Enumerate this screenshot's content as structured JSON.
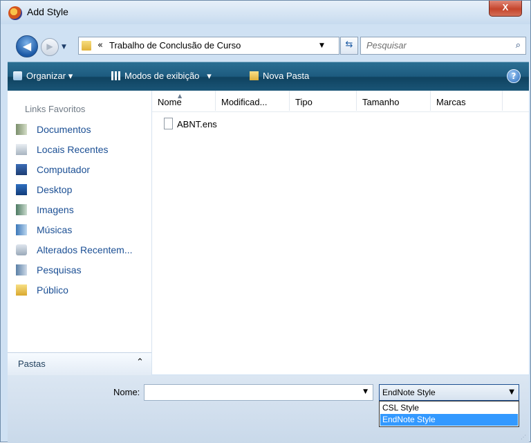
{
  "window": {
    "title": "Add Style",
    "close_label": "X"
  },
  "nav": {
    "breadcrumb_prefix": "«",
    "breadcrumb": "Trabalho de Conclusão de Curso",
    "search_placeholder": "Pesquisar"
  },
  "toolbar": {
    "organize": "Organizar",
    "views": "Modos de exibição",
    "new_folder": "Nova Pasta",
    "help": "?"
  },
  "sidebar": {
    "header": "Links Favoritos",
    "items": [
      {
        "label": "Documentos",
        "icon": "documents-icon"
      },
      {
        "label": "Locais Recentes",
        "icon": "recent-places-icon"
      },
      {
        "label": "Computador",
        "icon": "computer-icon"
      },
      {
        "label": "Desktop",
        "icon": "desktop-icon"
      },
      {
        "label": "Imagens",
        "icon": "pictures-icon"
      },
      {
        "label": "Músicas",
        "icon": "music-icon"
      },
      {
        "label": "Alterados Recentem...",
        "icon": "recently-changed-icon"
      },
      {
        "label": "Pesquisas",
        "icon": "searches-icon"
      },
      {
        "label": "Público",
        "icon": "public-folder-icon"
      }
    ],
    "folders_label": "Pastas"
  },
  "files": {
    "columns": [
      "Nome",
      "Modificad...",
      "Tipo",
      "Tamanho",
      "Marcas"
    ],
    "rows": [
      {
        "name": "ABNT.ens"
      }
    ]
  },
  "bottom": {
    "name_label": "Nome:",
    "name_value": "",
    "type_selected": "EndNote Style",
    "type_options": [
      "CSL Style",
      "EndNote Style"
    ],
    "type_highlighted": "EndNote Style"
  },
  "colors": {
    "accent": "#3399ff",
    "toolbar": "#1d5b7f",
    "link": "#1b4f94"
  }
}
